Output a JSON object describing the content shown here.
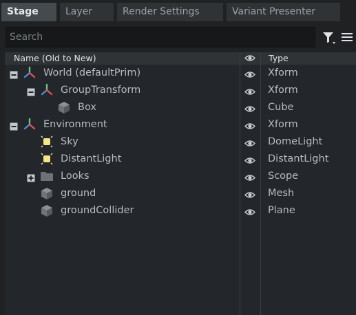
{
  "tabs": [
    {
      "label": "Stage",
      "active": true
    },
    {
      "label": "Layer",
      "active": false
    },
    {
      "label": "Render Settings",
      "active": false
    },
    {
      "label": "Variant Presenter",
      "active": false
    }
  ],
  "search": {
    "placeholder": "Search"
  },
  "columns": {
    "name": "Name (Old to New)",
    "visibility": "eye-icon",
    "type": "Type"
  },
  "rows": [
    {
      "name": "World (defaultPrim)",
      "type": "Xform",
      "icon": "xform-axes-icon",
      "expander": "collapse-icon",
      "depth": 0
    },
    {
      "name": "GroupTransform",
      "type": "Xform",
      "icon": "xform-axes-icon",
      "expander": "collapse-icon",
      "depth": 1
    },
    {
      "name": "Box",
      "type": "Cube",
      "icon": "mesh-cube-icon",
      "expander": "",
      "depth": 2
    },
    {
      "name": "Environment",
      "type": "Xform",
      "icon": "xform-axes-icon",
      "expander": "collapse-icon",
      "depth": 0
    },
    {
      "name": "Sky",
      "type": "DomeLight",
      "icon": "light-icon",
      "expander": "",
      "depth": 1
    },
    {
      "name": "DistantLight",
      "type": "DistantLight",
      "icon": "light-icon",
      "expander": "",
      "depth": 1
    },
    {
      "name": "Looks",
      "type": "Scope",
      "icon": "folder-icon",
      "expander": "expand-icon",
      "depth": 1
    },
    {
      "name": "ground",
      "type": "Mesh",
      "icon": "mesh-cube-icon",
      "expander": "",
      "depth": 1
    },
    {
      "name": "groundCollider",
      "type": "Plane",
      "icon": "mesh-cube-icon",
      "expander": "",
      "depth": 1
    }
  ],
  "colors": {
    "background": "#1f2123",
    "panel": "#23262a",
    "tab_active": "#454a4f",
    "tab_inactive": "#303336",
    "text": "#b6bcc0",
    "light_icon": "#f4e58a",
    "axis_red": "#e0525a",
    "axis_green": "#69c57d",
    "axis_blue": "#4a90d9"
  }
}
